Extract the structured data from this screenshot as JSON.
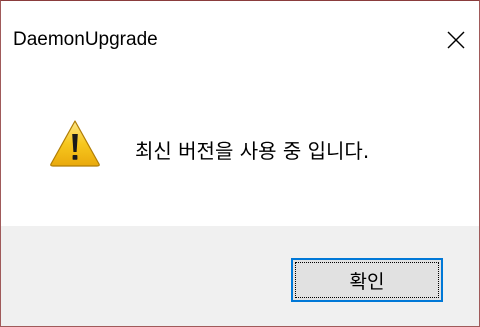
{
  "window": {
    "title": "DaemonUpgrade",
    "close_icon": "close-icon"
  },
  "content": {
    "icon": "warning-icon",
    "message": "최신 버전을 사용 중 입니다."
  },
  "footer": {
    "ok_label": "확인"
  },
  "colors": {
    "footer_bg": "#f0f0f0",
    "button_border_focus": "#0078d7",
    "button_bg": "#e1e1e1",
    "warning_yellow": "#f5c518"
  }
}
